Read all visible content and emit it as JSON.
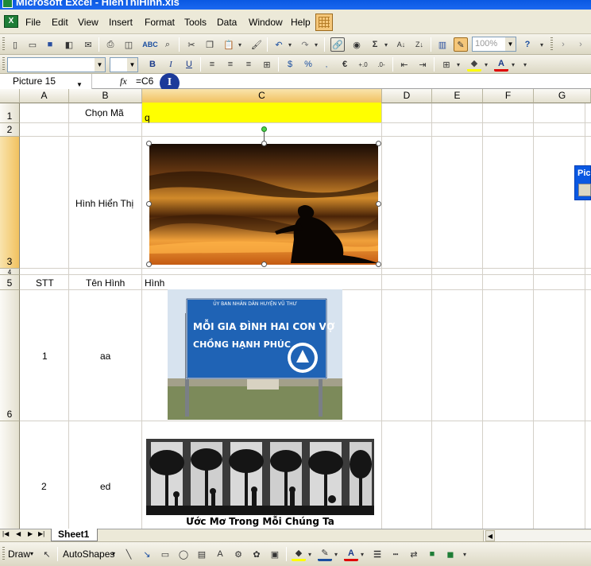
{
  "window": {
    "title": "Microsoft Excel - HienThiHinh.xls"
  },
  "menubar": {
    "items": [
      {
        "label": "File",
        "key": "F"
      },
      {
        "label": "Edit",
        "key": "E"
      },
      {
        "label": "View",
        "key": "V"
      },
      {
        "label": "Insert",
        "key": "I"
      },
      {
        "label": "Format",
        "key": "o"
      },
      {
        "label": "Tools",
        "key": "T"
      },
      {
        "label": "Data",
        "key": "D"
      },
      {
        "label": "Window",
        "key": "W"
      },
      {
        "label": "Help",
        "key": "H"
      }
    ]
  },
  "toolbar": {
    "zoom": "100%"
  },
  "formula_bar": {
    "name_box": "Picture 15",
    "fx": "fx",
    "formula": "=C6"
  },
  "columns": [
    "A",
    "B",
    "C",
    "D",
    "E",
    "F",
    "G"
  ],
  "rows": [
    "1",
    "2",
    "3",
    "4",
    "5",
    "6"
  ],
  "cells": {
    "B1": "Chọn Mã",
    "C1": "q",
    "B3": "Hình Hiển Thị",
    "A5": "STT",
    "B5": "Tên Hình",
    "C5": "Hình",
    "A6": "1",
    "B6": "aa",
    "A7": "2",
    "B7": "ed"
  },
  "pictures": {
    "sign": {
      "line1": "ỦY BAN NHÂN DÂN HUYỆN VŨ THƯ",
      "line2": "MỖI GIA ĐÌNH HAI CON VỢ",
      "line3": "CHỒNG HẠNH PHÚC"
    },
    "caption": "Ước Mơ Trong Mỗi Chúng Ta"
  },
  "sheet_tabs": [
    "Sheet1"
  ],
  "drawing_toolbar": {
    "draw": "Draw",
    "autoshapes": "AutoShapes"
  },
  "floating_toolbar": {
    "title": "Pic"
  },
  "colors": {
    "selected_cell": "#ffff00",
    "title_bar": "#0a58e2",
    "chrome": "#ece9d8"
  }
}
